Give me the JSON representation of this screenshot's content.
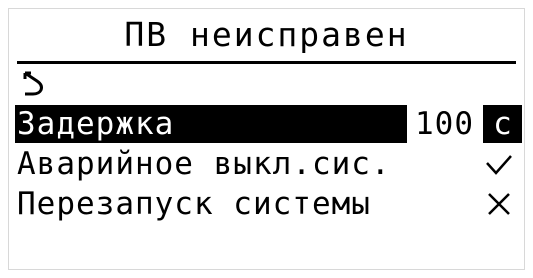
{
  "header": {
    "title": "ПВ неисправен"
  },
  "navigation": {
    "back_icon": "return-arrow-icon"
  },
  "menu": {
    "items": [
      {
        "label": "Задержка",
        "value": "100",
        "unit": "с",
        "selected": true
      },
      {
        "label": "Аварийное выкл.сис.",
        "mark_icon": "checkmark-icon",
        "selected": false
      },
      {
        "label": "Перезапуск системы",
        "mark_icon": "cross-icon",
        "selected": false
      }
    ]
  },
  "colors": {
    "foreground": "#000000",
    "background": "#ffffff",
    "highlight_text": "#ffffff"
  }
}
